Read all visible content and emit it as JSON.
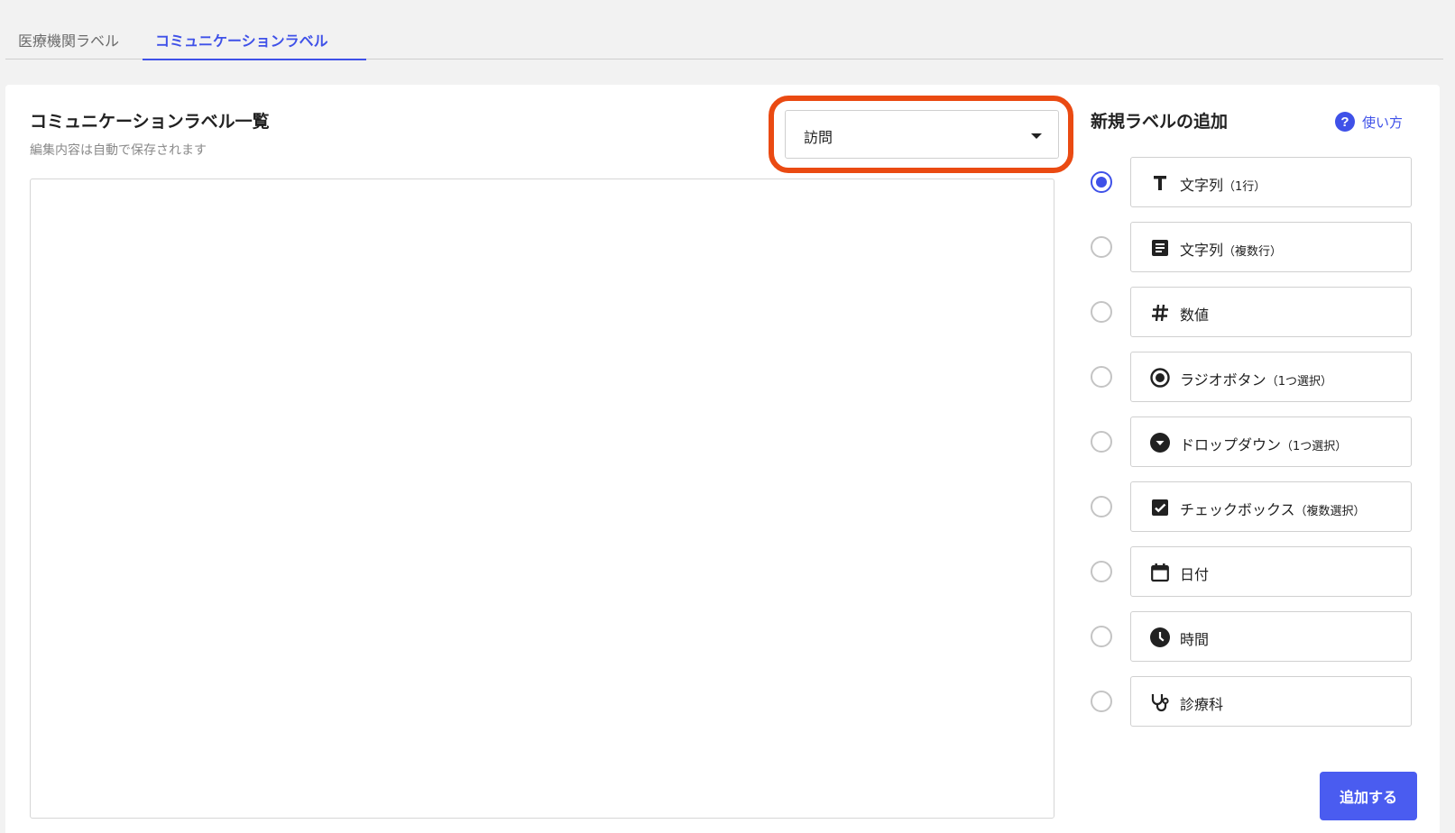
{
  "tabs": [
    {
      "label": "医療機関ラベル",
      "active": false
    },
    {
      "label": "コミュニケーションラベル",
      "active": true
    }
  ],
  "list": {
    "title": "コミュニケーションラベル一覧",
    "subtitle": "編集内容は自動で保存されます"
  },
  "filter": {
    "selected": "訪問"
  },
  "add_panel": {
    "title": "新規ラベルの追加",
    "help_label": "使い方",
    "options": [
      {
        "icon": "text-icon",
        "label": "文字列",
        "note": "（1行）",
        "checked": true
      },
      {
        "icon": "multiline-text-icon",
        "label": "文字列",
        "note": "（複数行）",
        "checked": false
      },
      {
        "icon": "number-icon",
        "label": "数値",
        "note": "",
        "checked": false
      },
      {
        "icon": "radio-button-icon",
        "label": "ラジオボタン",
        "note": "（1つ選択）",
        "checked": false
      },
      {
        "icon": "dropdown-icon",
        "label": "ドロップダウン",
        "note": "（1つ選択）",
        "checked": false
      },
      {
        "icon": "checkbox-icon",
        "label": "チェックボックス",
        "note": "（複数選択）",
        "checked": false
      },
      {
        "icon": "calendar-icon",
        "label": "日付",
        "note": "",
        "checked": false
      },
      {
        "icon": "clock-icon",
        "label": "時間",
        "note": "",
        "checked": false
      },
      {
        "icon": "stethoscope-icon",
        "label": "診療科",
        "note": "",
        "checked": false
      }
    ],
    "submit_label": "追加する"
  },
  "colors": {
    "accent": "#3f51e8",
    "highlight": "#ea4a12"
  }
}
